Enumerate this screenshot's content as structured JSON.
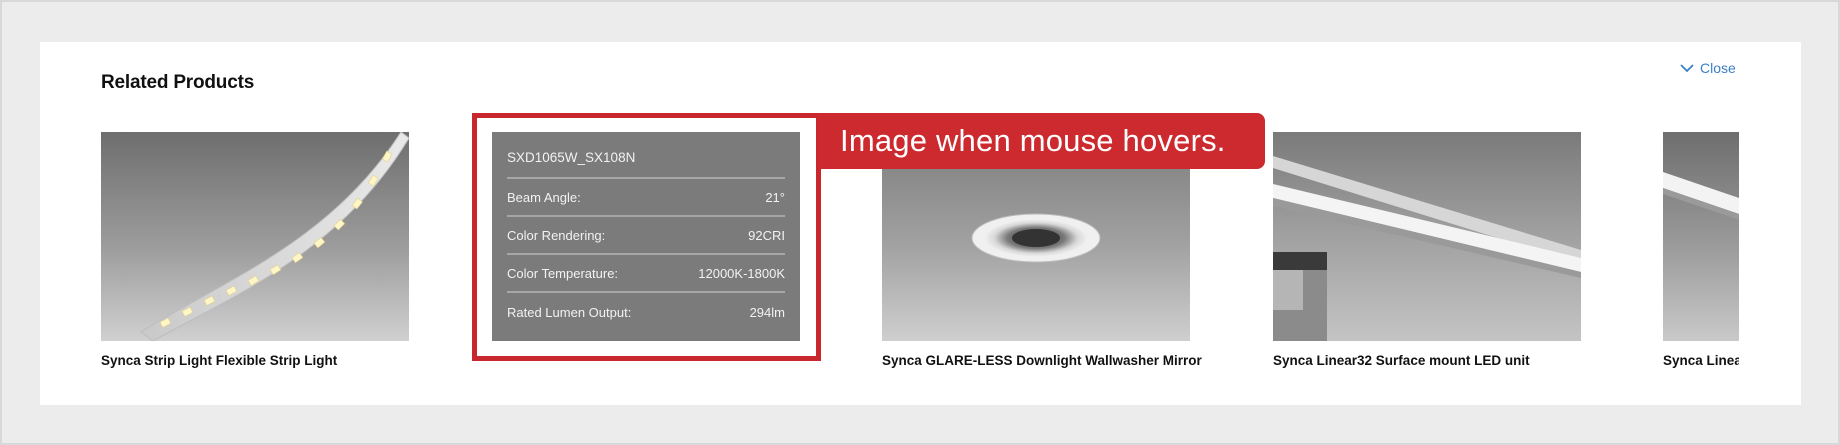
{
  "section": {
    "title": "Related Products",
    "close_label": "Close"
  },
  "products": [
    {
      "name": "Synca Strip Light Flexible Strip Light",
      "image_icon": "strip-light-image"
    },
    {
      "name": "",
      "hover": {
        "model": "SXD1065W_SX108N",
        "specs": [
          {
            "label": "Beam Angle:",
            "value": "21°"
          },
          {
            "label": "Color Rendering:",
            "value": "92CRI"
          },
          {
            "label": "Color Temperature:",
            "value": "12000K-1800K"
          },
          {
            "label": "Rated Lumen Output:",
            "value": "294lm"
          }
        ]
      }
    },
    {
      "name": "Synca GLARE-LESS Downlight Wallwasher Mirror",
      "image_icon": "downlight-image"
    },
    {
      "name": "Synca Linear32 Surface mount LED unit",
      "image_icon": "linear-light-image"
    },
    {
      "name": "Synca Linea",
      "image_icon": "linear-light-image"
    }
  ],
  "annotation": {
    "callout_text": "Image when mouse hovers.",
    "color": "#c8282d"
  },
  "colors": {
    "link": "#3a7fc8",
    "hover_bg": "#7b7b7b"
  }
}
